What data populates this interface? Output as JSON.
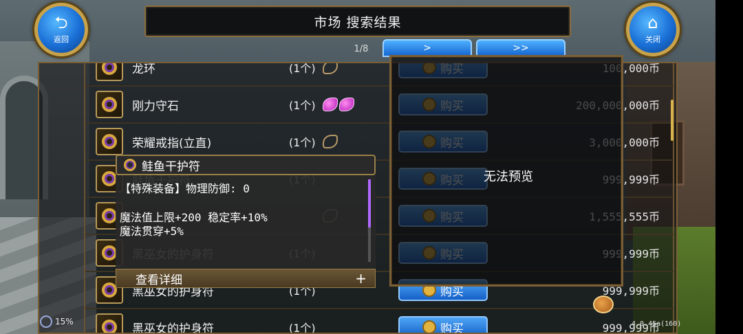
{
  "header": {
    "title": "市场  搜索结果",
    "back_label": "返回",
    "close_label": "关闭",
    "back_icon": "return-arrow-icon",
    "close_icon": "home-icon"
  },
  "pagination": {
    "page": "1/8",
    "next_label": ">",
    "last_label": ">>"
  },
  "rows": [
    {
      "name": "龙环",
      "qty": "(1个)",
      "gems": [
        "empty"
      ],
      "buy_label": "购买",
      "price": "100,000币"
    },
    {
      "name": "刚力守石",
      "qty": "(1个)",
      "gems": [
        "purple",
        "purple"
      ],
      "buy_label": "购买",
      "price": "200,000,000币"
    },
    {
      "name": "荣耀戒指(立直)",
      "qty": "(1个)",
      "gems": [
        "empty"
      ],
      "buy_label": "购买",
      "price": "3,000,000币"
    },
    {
      "name": "鲑鱼干护符",
      "qty": "(1个)",
      "gems": [],
      "buy_label": "购买",
      "price": "999,999币"
    },
    {
      "name": "",
      "qty": "",
      "gems": [
        "empty"
      ],
      "buy_label": "购买",
      "price": "1,555,555币"
    },
    {
      "name": "黑巫女的护身符",
      "qty": "(1个)",
      "gems": [],
      "buy_label": "购买",
      "price": "999,999币"
    },
    {
      "name": "黑巫女的护身符",
      "qty": "(1个)",
      "gems": [],
      "buy_label": "购买",
      "price": "999,999币"
    },
    {
      "name": "黑巫女的护身符",
      "qty": "(1个)",
      "gems": [],
      "buy_label": "购买",
      "price": "999,999币"
    }
  ],
  "preview": {
    "text": "无法预览"
  },
  "tooltip": {
    "title": "鲑鱼干护符",
    "line1": "【特殊装备】物理防御: 0",
    "line2": "魔法值上限+200 稳定率+10%",
    "line3": "魔法贯穿+5%",
    "footer_label": "查看详细",
    "footer_plus": "+"
  },
  "hud": {
    "battery": "15%",
    "version": "4.0.45a(160)"
  },
  "colors": {
    "gold_frame": "#8a6d3c",
    "button_blue": "#1466d0",
    "gem_purple": "#b21cb8"
  }
}
